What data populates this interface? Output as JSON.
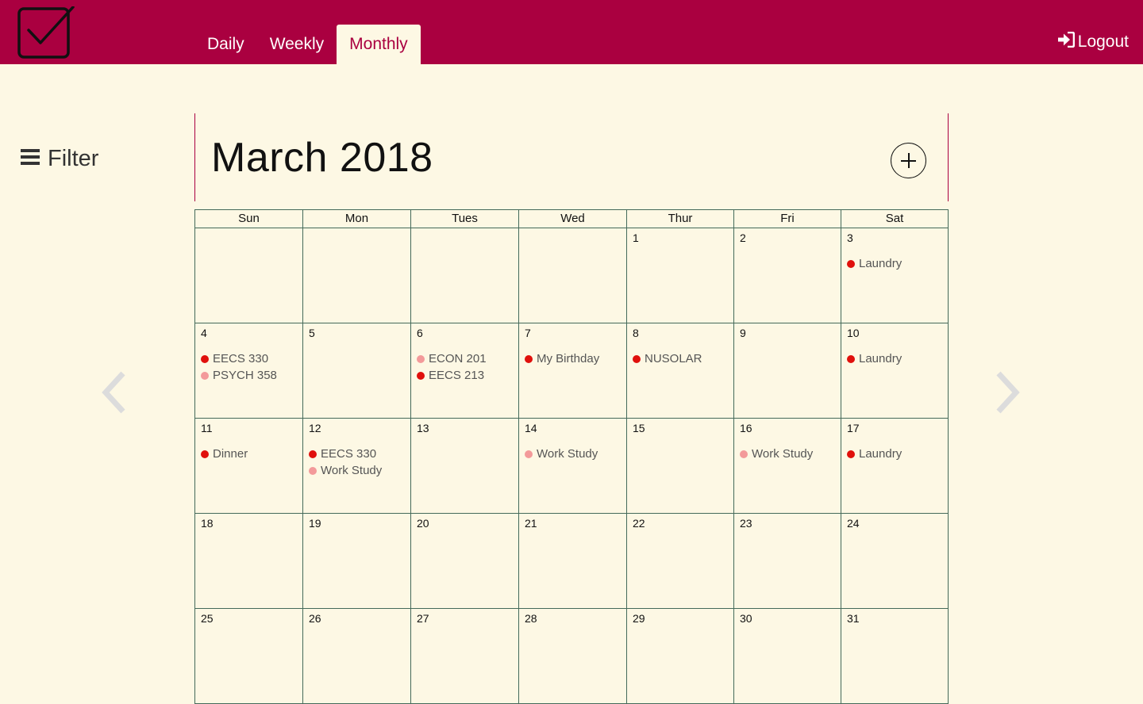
{
  "header": {
    "tabs": [
      {
        "label": "Daily",
        "active": false
      },
      {
        "label": "Weekly",
        "active": false
      },
      {
        "label": "Monthly",
        "active": true
      }
    ],
    "logout_label": "Logout",
    "bg_color": "#aa0040"
  },
  "sidebar": {
    "filter_label": "Filter"
  },
  "calendar": {
    "title": "March 2018",
    "day_names": [
      "Sun",
      "Mon",
      "Tues",
      "Wed",
      "Thur",
      "Fri",
      "Sat"
    ],
    "event_colors": {
      "red": "#e0100c",
      "pink": "#f39a9a"
    },
    "weeks": [
      [
        {
          "day": "",
          "events": []
        },
        {
          "day": "",
          "events": []
        },
        {
          "day": "",
          "events": []
        },
        {
          "day": "",
          "events": []
        },
        {
          "day": "1",
          "events": []
        },
        {
          "day": "2",
          "events": []
        },
        {
          "day": "3",
          "events": [
            {
              "name": "Laundry",
              "color": "red"
            }
          ]
        }
      ],
      [
        {
          "day": "4",
          "events": [
            {
              "name": "EECS 330",
              "color": "red"
            },
            {
              "name": "PSYCH 358",
              "color": "pink"
            }
          ]
        },
        {
          "day": "5",
          "events": []
        },
        {
          "day": "6",
          "events": [
            {
              "name": "ECON 201",
              "color": "pink"
            },
            {
              "name": "EECS 213",
              "color": "red"
            }
          ]
        },
        {
          "day": "7",
          "events": [
            {
              "name": "My Birthday",
              "color": "red"
            }
          ]
        },
        {
          "day": "8",
          "events": [
            {
              "name": "NUSOLAR",
              "color": "red"
            }
          ]
        },
        {
          "day": "9",
          "events": []
        },
        {
          "day": "10",
          "events": [
            {
              "name": "Laundry",
              "color": "red"
            }
          ]
        }
      ],
      [
        {
          "day": "11",
          "events": [
            {
              "name": "Dinner",
              "color": "red"
            }
          ]
        },
        {
          "day": "12",
          "events": [
            {
              "name": "EECS 330",
              "color": "red"
            },
            {
              "name": "Work Study",
              "color": "pink"
            }
          ]
        },
        {
          "day": "13",
          "events": []
        },
        {
          "day": "14",
          "events": [
            {
              "name": "Work Study",
              "color": "pink"
            }
          ]
        },
        {
          "day": "15",
          "events": []
        },
        {
          "day": "16",
          "events": [
            {
              "name": "Work Study",
              "color": "pink"
            }
          ]
        },
        {
          "day": "17",
          "events": [
            {
              "name": "Laundry",
              "color": "red"
            }
          ]
        }
      ],
      [
        {
          "day": "18",
          "events": []
        },
        {
          "day": "19",
          "events": []
        },
        {
          "day": "20",
          "events": []
        },
        {
          "day": "21",
          "events": []
        },
        {
          "day": "22",
          "events": []
        },
        {
          "day": "23",
          "events": []
        },
        {
          "day": "24",
          "events": []
        }
      ],
      [
        {
          "day": "25",
          "events": []
        },
        {
          "day": "26",
          "events": []
        },
        {
          "day": "27",
          "events": []
        },
        {
          "day": "28",
          "events": []
        },
        {
          "day": "29",
          "events": []
        },
        {
          "day": "30",
          "events": []
        },
        {
          "day": "31",
          "events": []
        }
      ]
    ]
  },
  "nav": {
    "prev_icon": "chevron-left-icon",
    "next_icon": "chevron-right-icon"
  }
}
